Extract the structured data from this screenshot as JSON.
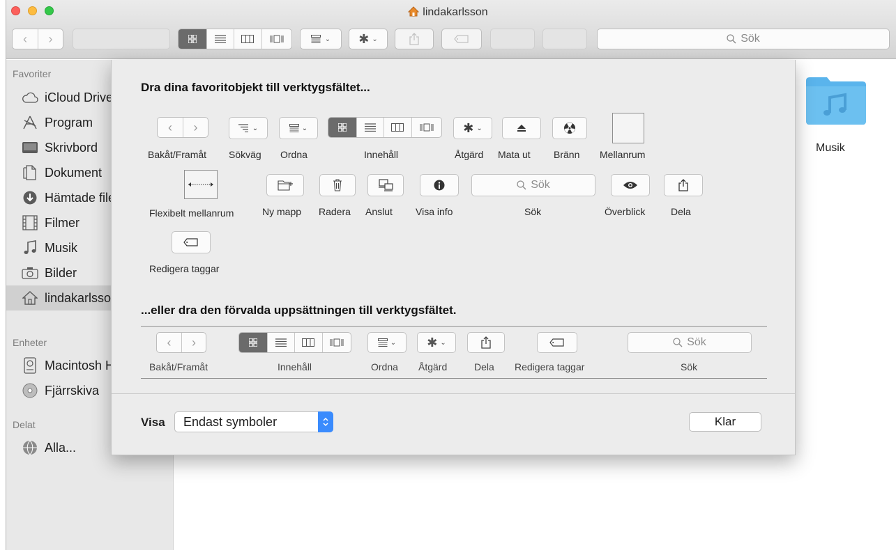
{
  "window": {
    "title": "lindakarlsson",
    "search_placeholder": "Sök"
  },
  "sidebar": {
    "sections": [
      {
        "header": "Favoriter",
        "items": [
          {
            "label": "iCloud Drive",
            "icon": "cloud-icon"
          },
          {
            "label": "Program",
            "icon": "applications-icon"
          },
          {
            "label": "Skrivbord",
            "icon": "desktop-icon"
          },
          {
            "label": "Dokument",
            "icon": "document-icon"
          },
          {
            "label": "Hämtade filer",
            "icon": "download-icon"
          },
          {
            "label": "Filmer",
            "icon": "film-icon"
          },
          {
            "label": "Musik",
            "icon": "music-icon"
          },
          {
            "label": "Bilder",
            "icon": "camera-icon"
          },
          {
            "label": "lindakarlsson",
            "icon": "home-icon",
            "selected": true
          }
        ]
      },
      {
        "header": "Enheter",
        "items": [
          {
            "label": "Macintosh HD",
            "icon": "drive-icon"
          },
          {
            "label": "Fjärrskiva",
            "icon": "disc-icon"
          }
        ]
      },
      {
        "header": "Delat",
        "items": [
          {
            "label": "Alla...",
            "icon": "network-icon"
          }
        ]
      }
    ]
  },
  "content": {
    "files": [
      {
        "name": "Musik",
        "icon": "music-folder-icon",
        "color": "#5ab4ec"
      }
    ]
  },
  "sheet": {
    "heading_favorites": "Dra dina favoritobjekt till verktygsfältet...",
    "heading_default": "...eller dra den förvalda uppsättningen till verktygsfältet.",
    "items": {
      "back_forward": "Bakåt/Framåt",
      "path": "Sökväg",
      "arrange": "Ordna",
      "view": "Innehåll",
      "action": "Åtgärd",
      "eject": "Mata ut",
      "burn": "Bränn",
      "space": "Mellanrum",
      "flexible_space": "Flexibelt mellanrum",
      "new_folder": "Ny mapp",
      "delete": "Radera",
      "connect": "Anslut",
      "get_info": "Visa info",
      "search": "Sök",
      "quick_look": "Överblick",
      "share": "Dela",
      "edit_tags": "Redigera taggar"
    },
    "search_placeholder": "Sök",
    "default_set": {
      "back_forward": "Bakåt/Framåt",
      "view": "Innehåll",
      "arrange": "Ordna",
      "action": "Åtgärd",
      "share": "Dela",
      "edit_tags": "Redigera taggar",
      "search": "Sök"
    },
    "show_label": "Visa",
    "show_value": "Endast symboler",
    "done_button": "Klar"
  },
  "colors": {
    "accent": "#3a8bfd",
    "folder": "#5ab4ec",
    "selected_segment": "#6b6b6b"
  }
}
